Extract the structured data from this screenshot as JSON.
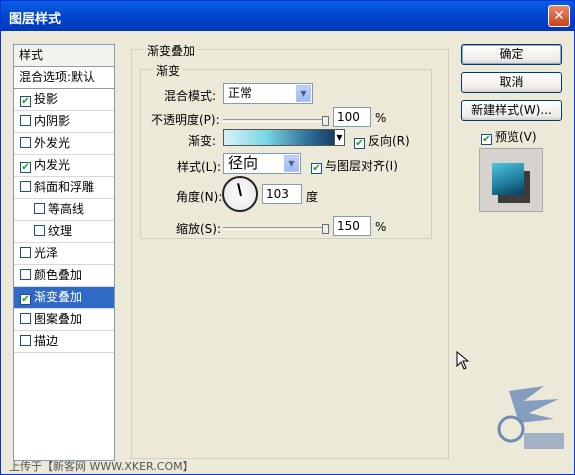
{
  "window": {
    "title": "图层样式",
    "close_label": "✕"
  },
  "sidebar": {
    "header": "样式",
    "blend_options": "混合选项:默认",
    "items": [
      {
        "label": "投影",
        "checked": true,
        "indent": false,
        "selected": false
      },
      {
        "label": "内阴影",
        "checked": false,
        "indent": false,
        "selected": false
      },
      {
        "label": "外发光",
        "checked": false,
        "indent": false,
        "selected": false
      },
      {
        "label": "内发光",
        "checked": true,
        "indent": false,
        "selected": false
      },
      {
        "label": "斜面和浮雕",
        "checked": false,
        "indent": false,
        "selected": false
      },
      {
        "label": "等高线",
        "checked": false,
        "indent": true,
        "selected": false
      },
      {
        "label": "纹理",
        "checked": false,
        "indent": true,
        "selected": false
      },
      {
        "label": "光泽",
        "checked": false,
        "indent": false,
        "selected": false
      },
      {
        "label": "颜色叠加",
        "checked": false,
        "indent": false,
        "selected": false
      },
      {
        "label": "渐变叠加",
        "checked": true,
        "indent": false,
        "selected": true
      },
      {
        "label": "图案叠加",
        "checked": false,
        "indent": false,
        "selected": false
      },
      {
        "label": "描边",
        "checked": false,
        "indent": false,
        "selected": false
      }
    ]
  },
  "gradient_overlay": {
    "group_title": "渐变叠加",
    "subgroup_title": "渐变",
    "blend_mode_label": "混合模式:",
    "blend_mode_value": "正常",
    "opacity_label": "不透明度(P):",
    "opacity_value": "100",
    "opacity_unit": "%",
    "opacity_level": 1.0,
    "gradient_label": "渐变:",
    "reverse_label": "反向(R)",
    "reverse_checked": true,
    "style_label": "样式(L):",
    "style_value": "径向",
    "align_label": "与图层对齐(I)",
    "align_checked": true,
    "angle_label": "角度(N):",
    "angle_value": "103",
    "angle_unit": "度",
    "scale_label": "缩放(S):",
    "scale_value": "150",
    "scale_unit": "%",
    "scale_level": 1.0
  },
  "buttons": {
    "ok": "确定",
    "cancel": "取消",
    "new_style": "新建样式(W)...",
    "preview_label": "预览(V)",
    "preview_checked": true
  },
  "footer": {
    "watermark": "上传于【新客网 WWW.XKER.COM】"
  },
  "icons": {
    "checkmark": "✔",
    "dropdown": "▼"
  }
}
